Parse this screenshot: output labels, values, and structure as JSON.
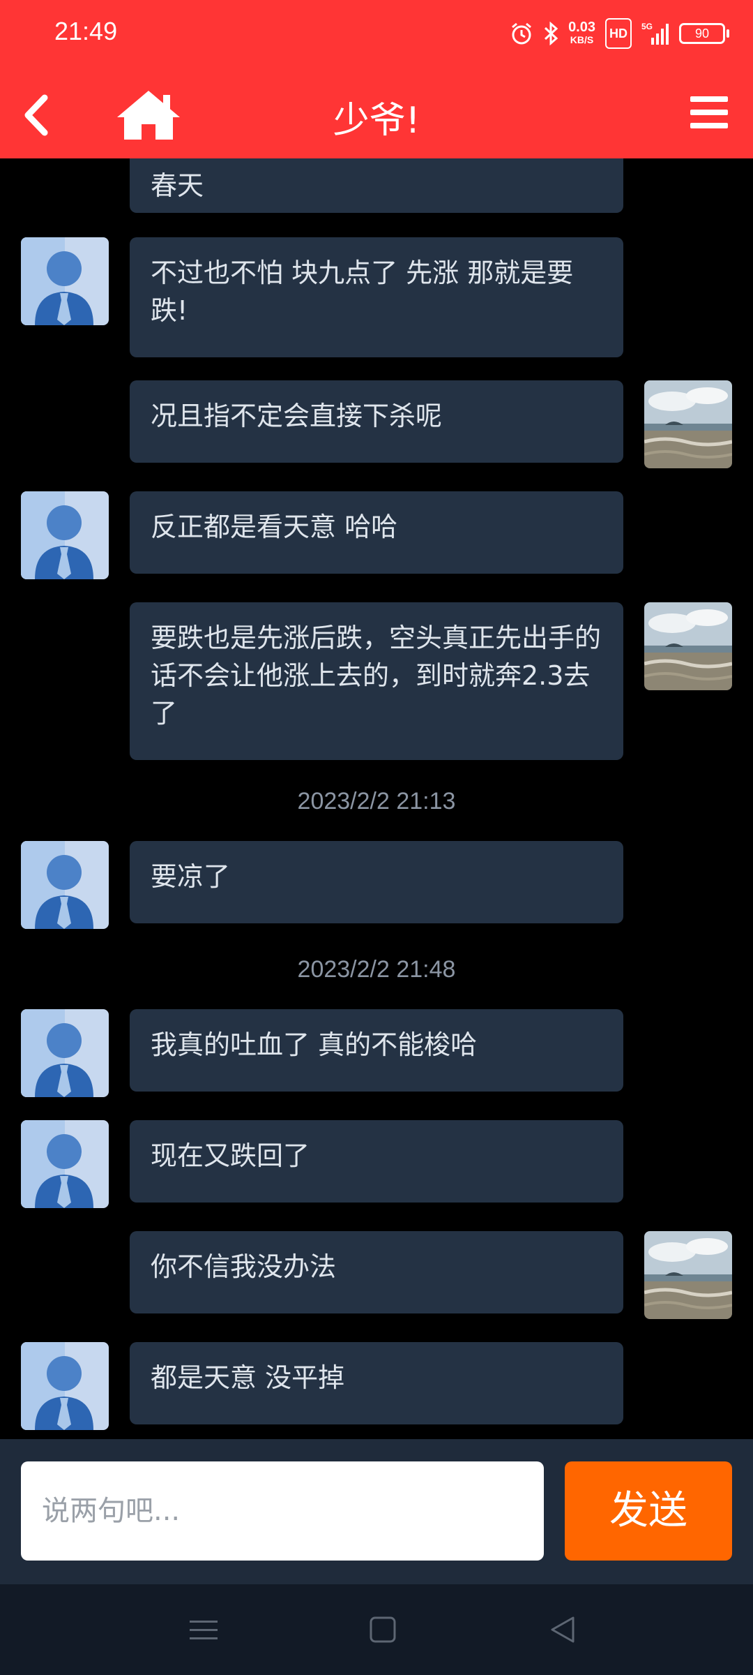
{
  "status_bar": {
    "time": "21:49",
    "net_speed": "0.03",
    "net_unit": "KB/S",
    "hd": "HD",
    "signal": "5G",
    "battery": "90"
  },
  "header": {
    "title": "少爷!",
    "accent_color": "#ff3535"
  },
  "messages": [
    {
      "side": "left",
      "text": "春天",
      "avatar": "default-user-avatar"
    },
    {
      "side": "left",
      "text": "不过也不怕 块九点了 先涨 那就是要跌!",
      "avatar": "default-user-avatar"
    },
    {
      "side": "right",
      "text": "况且指不定会直接下杀呢",
      "avatar": "seascape-avatar"
    },
    {
      "side": "left",
      "text": "反正都是看天意 哈哈",
      "avatar": "default-user-avatar"
    },
    {
      "side": "right",
      "text": "要跌也是先涨后跌，空头真正先出手的话不会让他涨上去的，到时就奔2.3去了",
      "avatar": "seascape-avatar"
    },
    {
      "timestamp": "2023/2/2 21:13"
    },
    {
      "side": "left",
      "text": "要凉了",
      "avatar": "default-user-avatar"
    },
    {
      "timestamp": "2023/2/2 21:48"
    },
    {
      "side": "left",
      "text": "我真的吐血了 真的不能梭哈",
      "avatar": "default-user-avatar"
    },
    {
      "side": "left",
      "text": "现在又跌回了",
      "avatar": "default-user-avatar"
    },
    {
      "side": "right",
      "text": "你不信我没办法",
      "avatar": "seascape-avatar"
    },
    {
      "side": "left",
      "text": "都是天意 没平掉",
      "avatar": "default-user-avatar"
    }
  ],
  "composer": {
    "placeholder": "说两句吧...",
    "send_label": "发送",
    "send_color": "#ff6600"
  }
}
